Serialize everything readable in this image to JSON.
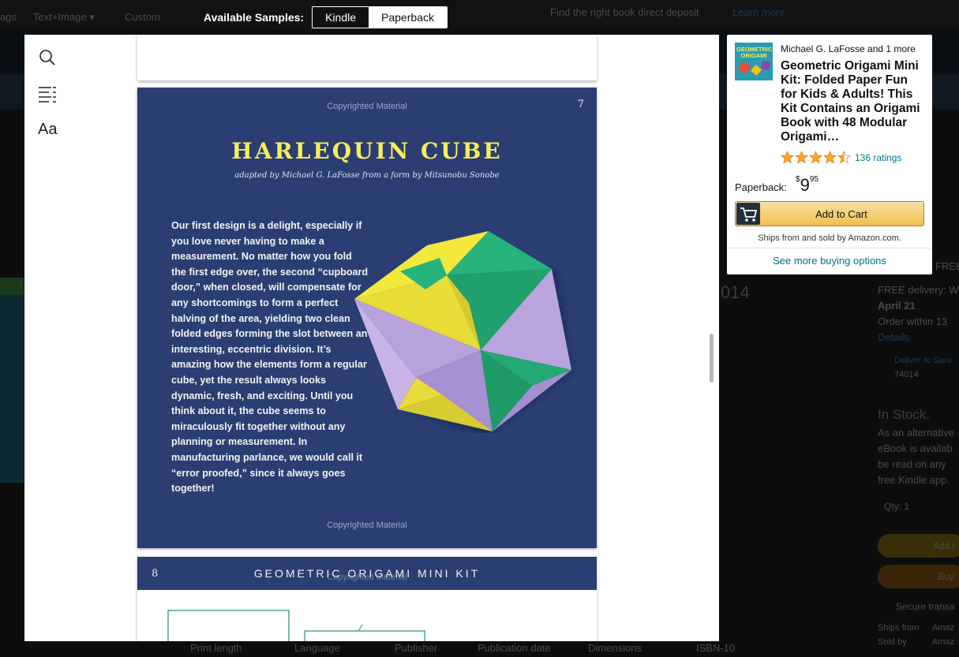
{
  "samples": {
    "label": "Available Samples:",
    "options": [
      "Kindle",
      "Paperback"
    ],
    "selected": "Kindle"
  },
  "reader": {
    "tools": {
      "search": "search-icon",
      "toc": "table-of-contents-icon",
      "font": "Aa"
    },
    "page": {
      "copyright_top": "Copyrighted Material",
      "number": "7",
      "title": "HARLEQUIN CUBE",
      "subtitle": "adapted by Michael G. LaFosse from a form by Mitsunobu Sonobe",
      "body": "Our first design is a delight, especially if you love never having to make a measurement. No matter how you fold the first edge over, the second “cupboard door,” when closed, will compensate for any shortcomings to form a perfect halving of the area, yielding two clean folded edges forming the slot between an interesting, eccentric division. It’s amazing how the elements form a regular cube, yet the result always looks dynamic, fresh, and exciting. Until you think about it, the cube seems to miraculously fit together without any planning or measurement. In manufacturing parlance, we would call it “error proofed,” since it always goes together!",
      "copyright_bottom": "Copyrighted Material",
      "colors": {
        "background": "#2a3e73",
        "title": "#f6ee58"
      }
    },
    "next_page": {
      "number": "8",
      "header": "GEOMETRIC ORIGAMI MINI KIT",
      "copyright": "Copyrighted Material"
    }
  },
  "buybox": {
    "author": "Michael G. LaFosse and 1 more",
    "title": "Geometric Origami Mini Kit: Folded Paper Fun for Kids & Adults! This Kit Contains an Origami Book with 48 Modular Origami…",
    "thumbnail_text": "GEOMETRIC ORIGAMI",
    "rating": 4.5,
    "ratings_text": "136 ratings",
    "format": "Paperback:",
    "price": {
      "symbol": "$",
      "whole": "9",
      "fraction": "95"
    },
    "add_to_cart": "Add to Cart",
    "ships": "Ships from and sold by Amazon.com.",
    "more_options": "See more buying options",
    "colors": {
      "link": "#007185",
      "button": "#f0c14b",
      "star": "#ffa41c"
    }
  },
  "background_page": {
    "top_items": [
      "ags",
      "Text+Image ▾",
      "Custom"
    ],
    "promo": "Find the right book direct deposit",
    "learn_more": "Learn more",
    "details": [
      "FREE delivery: W",
      "April 21",
      "Order within 13",
      "Details",
      "Deliver to Sara",
      "74014",
      "In Stock.",
      "As an alternative",
      "eBook is availab",
      "be read on any",
      "free Kindle app.",
      "Qty: 1",
      "Add t",
      "Buy",
      "Secure transa",
      "Ships from",
      "Sold by",
      "Amaz",
      "Amaz"
    ],
    "footer": [
      "Print length",
      "Language",
      "Publisher",
      "Publication date",
      "Dimensions",
      "ISBN-10"
    ],
    "misc": [
      "014",
      "FREE"
    ]
  }
}
